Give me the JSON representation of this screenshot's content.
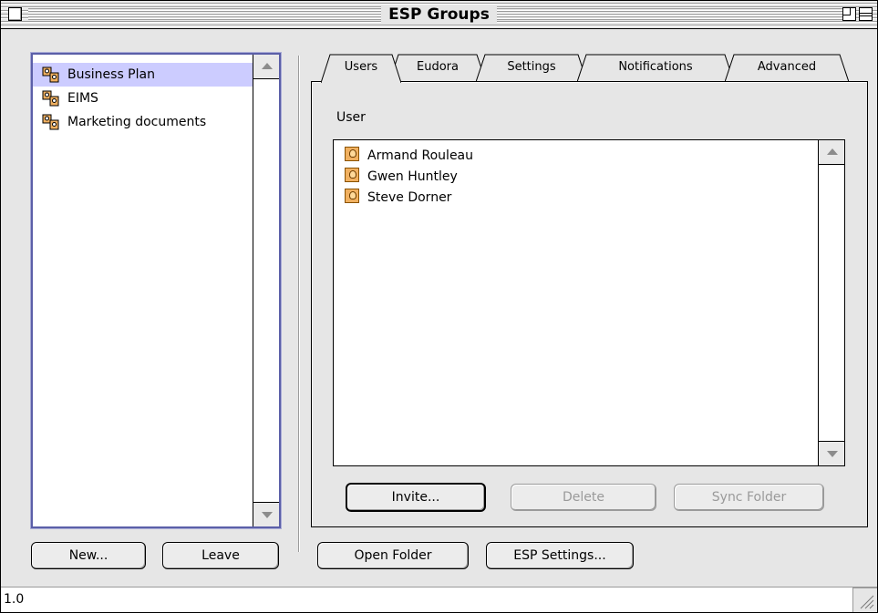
{
  "window": {
    "title": "ESP Groups"
  },
  "groups": {
    "items": [
      {
        "label": "Business Plan",
        "selected": true
      },
      {
        "label": "EIMS",
        "selected": false
      },
      {
        "label": "Marketing documents",
        "selected": false
      }
    ],
    "new_label": "New...",
    "leave_label": "Leave"
  },
  "tabs": [
    {
      "label": "Users",
      "active": true
    },
    {
      "label": "Eudora",
      "active": false
    },
    {
      "label": "Settings",
      "active": false
    },
    {
      "label": "Notifications",
      "active": false
    },
    {
      "label": "Advanced",
      "active": false
    }
  ],
  "users_panel": {
    "label": "User",
    "users": [
      "Armand Rouleau",
      "Gwen Huntley",
      "Steve Dorner"
    ],
    "invite_label": "Invite...",
    "delete_label": "Delete",
    "sync_label": "Sync Folder"
  },
  "bottom": {
    "open_folder_label": "Open Folder",
    "esp_settings_label": "ESP Settings..."
  },
  "status": {
    "version": "1.0"
  },
  "colors": {
    "selection": "#ccccff",
    "focus_ring": "#5b5fa8",
    "window_bg": "#e6e6e6"
  }
}
